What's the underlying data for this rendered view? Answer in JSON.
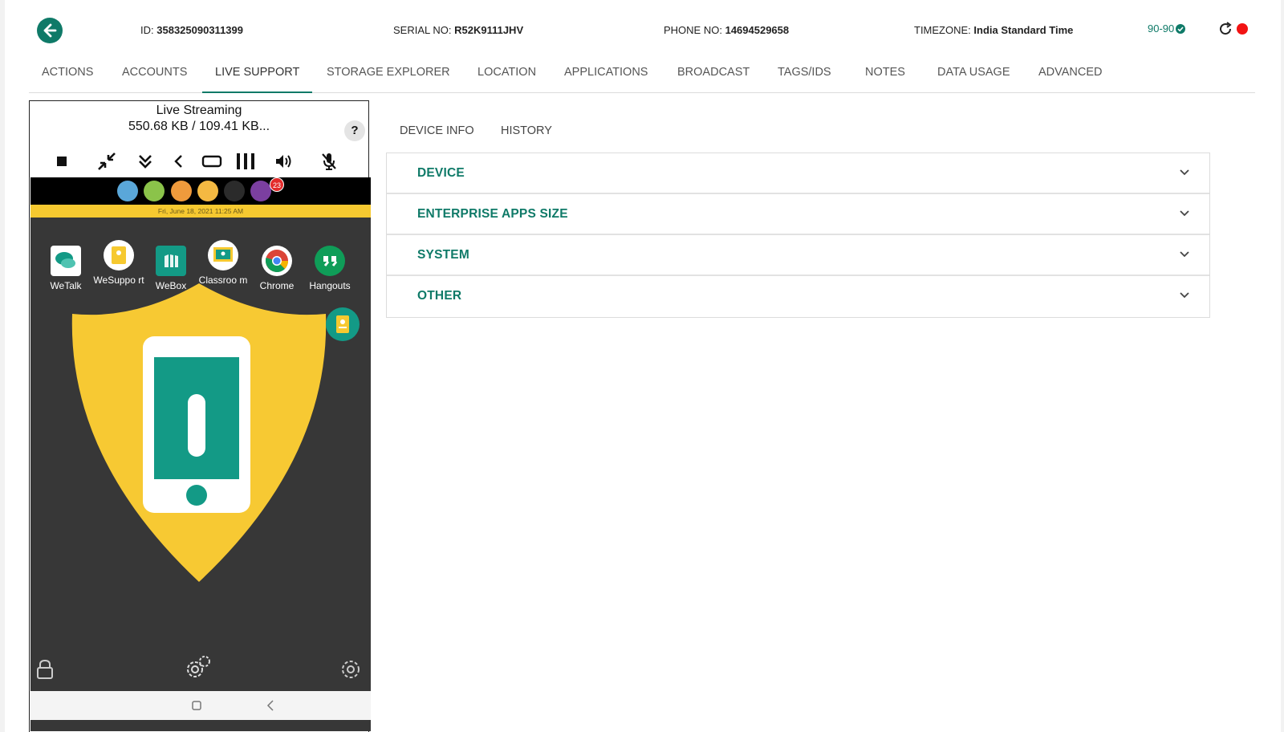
{
  "header": {
    "id_label": "ID:",
    "id_value": "358325090311399",
    "serial_label": "SERIAL NO:",
    "serial_value": "R52K9111JHV",
    "phone_label": "PHONE NO:",
    "phone_value": "14694529658",
    "timezone_label": "TIMEZONE:",
    "timezone_value": "India Standard Time",
    "policy": "90-90",
    "status_color": "#f21313"
  },
  "tabs": [
    {
      "label": "ACTIONS"
    },
    {
      "label": "ACCOUNTS"
    },
    {
      "label": "LIVE SUPPORT"
    },
    {
      "label": "STORAGE EXPLORER"
    },
    {
      "label": "LOCATION"
    },
    {
      "label": "APPLICATIONS"
    },
    {
      "label": "BROADCAST"
    },
    {
      "label": "TAGS/IDS"
    },
    {
      "label": "NOTES"
    },
    {
      "label": "DATA USAGE"
    },
    {
      "label": "ADVANCED"
    }
  ],
  "active_tab": "LIVE SUPPORT",
  "live_stream": {
    "title": "Live Streaming",
    "stats": "550.68 KB / 109.41 KB...",
    "help": "?",
    "controls": [
      "stop-icon",
      "minimize-icon",
      "scroll-down-icon",
      "back-icon",
      "rotate-icon",
      "recent-apps-icon",
      "volume-icon",
      "mic-off-icon"
    ]
  },
  "device_screen": {
    "notification_count": "23",
    "date_time": "Fri, June 18, 2021  11:25 AM",
    "apps": [
      {
        "label": "WeTalk"
      },
      {
        "label": "WeSuppo rt"
      },
      {
        "label": "WeBox"
      },
      {
        "label": "Classroo m"
      },
      {
        "label": "Chrome"
      },
      {
        "label": "Hangouts"
      }
    ],
    "shield_color": "#f7c933",
    "accent_color": "#139a86"
  },
  "sub_tabs": [
    {
      "label": "DEVICE INFO"
    },
    {
      "label": "HISTORY"
    }
  ],
  "sections": [
    {
      "label": "DEVICE"
    },
    {
      "label": "ENTERPRISE APPS SIZE"
    },
    {
      "label": "SYSTEM"
    },
    {
      "label": "OTHER"
    }
  ],
  "brand_color": "#0f7a68"
}
